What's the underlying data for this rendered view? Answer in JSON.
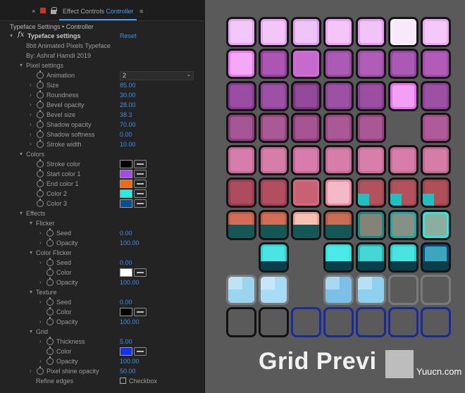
{
  "tab": {
    "close": "×",
    "title_prefix": "Effect Controls",
    "title_layer": "Controller",
    "menu": "≡"
  },
  "breadcrumb": "Typeface Settings • Controller",
  "effect": {
    "name": "Typeface settings",
    "reset": "Reset",
    "title": "8bit Animated Pixels Typeface",
    "author": "By: Ashraf Hamdi 2019"
  },
  "pixel_settings": {
    "label": "Pixel settings",
    "animation_label": "Animation",
    "animation_value": "2",
    "size_label": "Size",
    "size_value": "85.00",
    "roundness_label": "Roundness",
    "roundness_value": "30.00",
    "bevel_opacity_label": "Bevel opacity",
    "bevel_opacity_value": "28.00",
    "bevel_size_label": "Bevel size",
    "bevel_size_value": "38.3",
    "shadow_opacity_label": "Shadow opacity",
    "shadow_opacity_value": "70.00",
    "shadow_softness_label": "Shadow softness",
    "shadow_softness_value": "0.00",
    "stroke_width_label": "Stroke width",
    "stroke_width_value": "10.00"
  },
  "colors": {
    "label": "Colors",
    "stroke_color_label": "Stroke color",
    "stroke_color": "#000000",
    "start_color_label": "Start color 1",
    "start_color": "#a64ce6",
    "end_color_label": "End color 1",
    "end_color": "#f26a10",
    "color2_label": "Color 2",
    "color2": "#22ece6",
    "color3_label": "Color 3",
    "color3": "#0b4c8c"
  },
  "effects": {
    "label": "Effects",
    "flicker": {
      "label": "Flicker",
      "seed_label": "Seed",
      "seed_value": "0.00",
      "opacity_label": "Opacity",
      "opacity_value": "100.00"
    },
    "color_flicker": {
      "label": "Color Flicker",
      "seed_label": "Seed",
      "seed_value": "0.00",
      "color_label": "Color",
      "color": "#ffffff",
      "opacity_label": "Opacity",
      "opacity_value": "100.00"
    },
    "texture": {
      "label": "Texture",
      "seed_label": "Seed",
      "seed_value": "0.00",
      "color_label": "Color",
      "color": "#000000",
      "opacity_label": "Opacity",
      "opacity_value": "100.00"
    },
    "grid": {
      "label": "Grid",
      "thickness_label": "Thickness",
      "thickness_value": "5.00",
      "color_label": "Color",
      "color": "#1530f0",
      "opacity_label": "Opacity",
      "opacity_value": "100.00"
    },
    "pixel_shine_label": "Pixel shine opacity",
    "pixel_shine_value": "50.00",
    "refine_edges_label": "Refine edges",
    "refine_edges_checkbox": "Checkbox"
  },
  "preview": {
    "title": "Grid Previ",
    "watermark": "Yuucn.com"
  }
}
